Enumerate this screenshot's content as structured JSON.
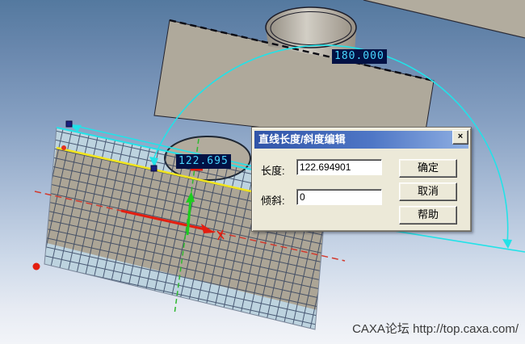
{
  "viewport": {
    "dimension_labels": [
      {
        "id": "dim-length",
        "text": "122.695"
      },
      {
        "id": "dim-angle",
        "text": "180.000"
      }
    ],
    "watermark": "CAXA论坛 http://top.caxa.com/",
    "colors": {
      "highlight_cyan": "#22e2e8",
      "selected_line_yellow": "#f2e520",
      "axis_red": "#e3321e",
      "axis_green": "#2ec42e",
      "dim_label_bg": "#021144",
      "dim_label_text": "#49d6ff",
      "dialog_face": "#ECE9D8",
      "titlebar_blue": "#3054a8"
    }
  },
  "dialog": {
    "title": "直线长度/斜度编辑",
    "close_label": "×",
    "fields": [
      {
        "label": "长度:",
        "value": "122.694901"
      },
      {
        "label": "倾斜:",
        "value": "0"
      }
    ],
    "buttons": [
      {
        "label": "确定"
      },
      {
        "label": "取消"
      },
      {
        "label": "帮助"
      }
    ]
  }
}
